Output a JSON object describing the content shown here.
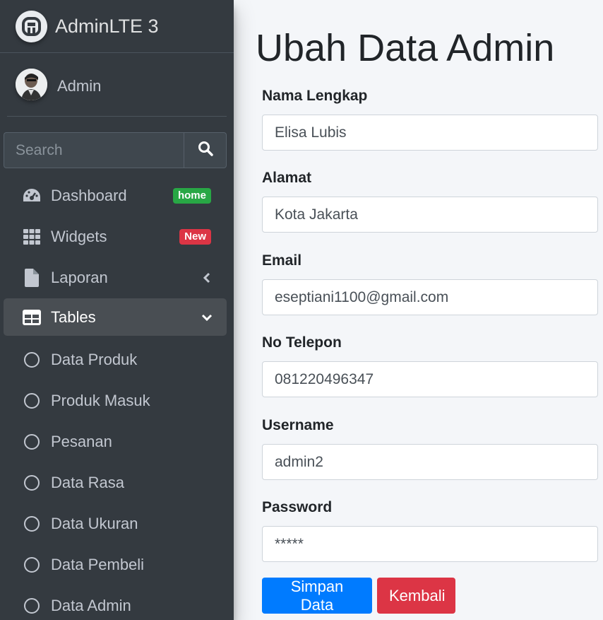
{
  "brand": {
    "name": "AdminLTE 3",
    "icon": "adminlte-logo-icon"
  },
  "user": {
    "name": "Admin",
    "avatar": "avatar-icon"
  },
  "search": {
    "placeholder": "Search",
    "icon": "search-icon"
  },
  "nav": {
    "dashboard": {
      "label": "Dashboard",
      "badge": "home",
      "icon": "tachometer-icon"
    },
    "widgets": {
      "label": "Widgets",
      "badge": "New",
      "icon": "th-icon"
    },
    "laporan": {
      "label": "Laporan",
      "icon": "file-icon"
    },
    "tables": {
      "label": "Tables",
      "icon": "table-icon"
    },
    "sub_items": [
      {
        "label": "Data Produk",
        "icon": "circle-icon"
      },
      {
        "label": "Produk Masuk",
        "icon": "circle-icon"
      },
      {
        "label": "Pesanan",
        "icon": "circle-icon"
      },
      {
        "label": "Data Rasa",
        "icon": "circle-icon"
      },
      {
        "label": "Data Ukuran",
        "icon": "circle-icon"
      },
      {
        "label": "Data Pembeli",
        "icon": "circle-icon"
      },
      {
        "label": "Data Admin",
        "icon": "circle-icon"
      }
    ]
  },
  "page": {
    "title": "Ubah Data Admin"
  },
  "form": {
    "nama": {
      "label": "Nama Lengkap",
      "value": "Elisa Lubis"
    },
    "alamat": {
      "label": "Alamat",
      "value": "Kota Jakarta"
    },
    "email": {
      "label": "Email",
      "value": "eseptiani1100@gmail.com"
    },
    "telepon": {
      "label": "No Telepon",
      "value": "081220496347"
    },
    "username": {
      "label": "Username",
      "value": "admin2"
    },
    "password": {
      "label": "Password",
      "value": "*****"
    },
    "save_label": "Simpan Data",
    "back_label": "Kembali"
  },
  "colors": {
    "sidebar": "#343a40",
    "primary": "#007bff",
    "danger": "#dc3545",
    "success": "#28a745",
    "background": "#f4f6f9"
  }
}
